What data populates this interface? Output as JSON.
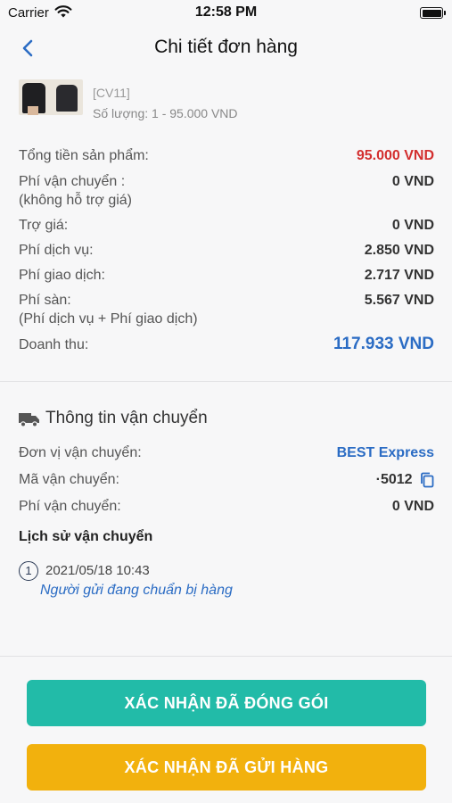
{
  "status_bar": {
    "carrier": "Carrier",
    "time": "12:58 PM"
  },
  "nav": {
    "title": "Chi tiết đơn hàng"
  },
  "product": {
    "sku": "[CV11]",
    "quantity_line": "Số lượng: 1 - 95.000 VND"
  },
  "summary": {
    "product_total_label": "Tổng tiền sản phẩm:",
    "product_total_value": "95.000 VND",
    "shipping_fee_label": "Phí vận chuyển :",
    "shipping_fee_sub": "(không hỗ trợ giá)",
    "shipping_fee_value": "0 VND",
    "subsidy_label": "Trợ giá:",
    "subsidy_value": "0 VND",
    "service_fee_label": "Phí dịch vụ:",
    "service_fee_value": "2.850 VND",
    "transaction_fee_label": "Phí giao dịch:",
    "transaction_fee_value": "2.717 VND",
    "platform_fee_label": "Phí sàn:",
    "platform_fee_sub": "(Phí dịch vụ + Phí giao dịch)",
    "platform_fee_value": "5.567 VND",
    "revenue_label": "Doanh thu:",
    "revenue_value": "117.933 VND"
  },
  "shipping": {
    "title": "Thông tin vận chuyển",
    "carrier_label": "Đơn vị vận chuyển:",
    "carrier_value": "BEST Express",
    "tracking_label": "Mã vận chuyển:",
    "tracking_value": "·5012",
    "fee_label": "Phí vận chuyển:",
    "fee_value": "0 VND",
    "history_title": "Lịch sử vận chuyển",
    "history": [
      {
        "step": "1",
        "time": "2021/05/18 10:43",
        "description": "Người gửi đang chuẩn bị hàng"
      }
    ]
  },
  "actions": {
    "confirm_packed": "XÁC NHẬN ĐÃ ĐÓNG GÓI",
    "confirm_shipped": "XÁC NHẬN ĐÃ GỬI HÀNG"
  },
  "colors": {
    "accent_blue": "#2b6cc4",
    "total_red": "#d32f2f",
    "pack_button": "#22bba8",
    "ship_button": "#f2b10d"
  }
}
